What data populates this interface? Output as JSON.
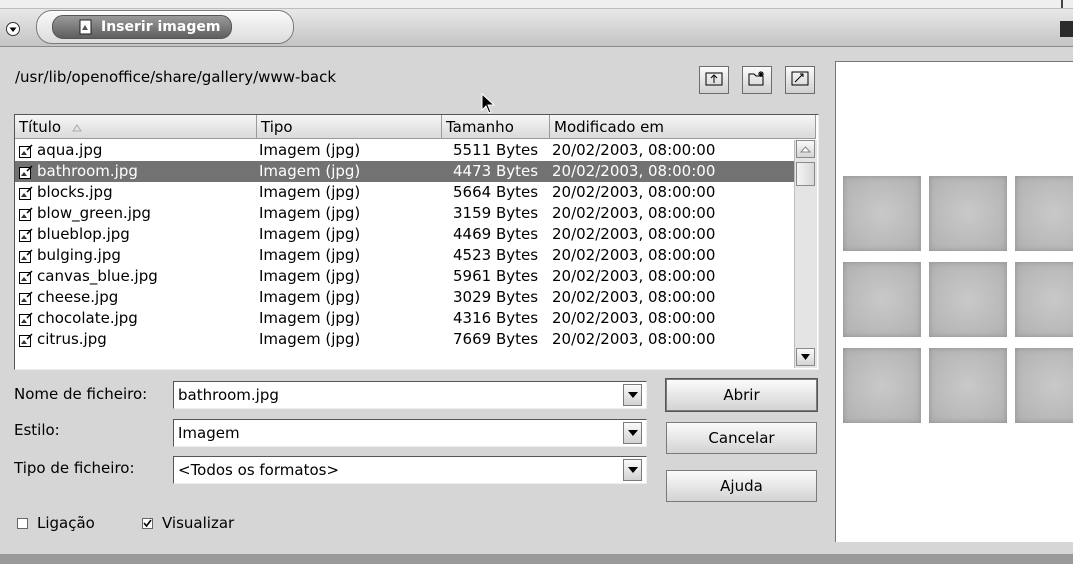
{
  "window": {
    "title": "Inserir imagem"
  },
  "path": "/usr/lib/openoffice/share/gallery/www-back",
  "toolbar": [
    "folder-up-icon",
    "new-folder-icon",
    "default-dir-icon"
  ],
  "list": {
    "headers": [
      "Título",
      "Tipo",
      "Tamanho",
      "Modificado em"
    ],
    "rows": [
      {
        "name": "aqua.jpg",
        "type": "Imagem (jpg)",
        "size": "5511 Bytes",
        "date": "20/02/2003, 08:00:00"
      },
      {
        "name": "bathroom.jpg",
        "type": "Imagem (jpg)",
        "size": "4473 Bytes",
        "date": "20/02/2003, 08:00:00",
        "selected": true
      },
      {
        "name": "blocks.jpg",
        "type": "Imagem (jpg)",
        "size": "5664 Bytes",
        "date": "20/02/2003, 08:00:00"
      },
      {
        "name": "blow_green.jpg",
        "type": "Imagem (jpg)",
        "size": "3159 Bytes",
        "date": "20/02/2003, 08:00:00"
      },
      {
        "name": "blueblop.jpg",
        "type": "Imagem (jpg)",
        "size": "4469 Bytes",
        "date": "20/02/2003, 08:00:00"
      },
      {
        "name": "bulging.jpg",
        "type": "Imagem (jpg)",
        "size": "4523 Bytes",
        "date": "20/02/2003, 08:00:00"
      },
      {
        "name": "canvas_blue.jpg",
        "type": "Imagem (jpg)",
        "size": "5961 Bytes",
        "date": "20/02/2003, 08:00:00"
      },
      {
        "name": "cheese.jpg",
        "type": "Imagem (jpg)",
        "size": "3029 Bytes",
        "date": "20/02/2003, 08:00:00"
      },
      {
        "name": "chocolate.jpg",
        "type": "Imagem (jpg)",
        "size": "4316 Bytes",
        "date": "20/02/2003, 08:00:00"
      },
      {
        "name": "citrus.jpg",
        "type": "Imagem (jpg)",
        "size": "7669 Bytes",
        "date": "20/02/2003, 08:00:00"
      }
    ]
  },
  "form": {
    "filename_label": "Nome de ficheiro:",
    "filename_value": "bathroom.jpg",
    "style_label": "Estilo:",
    "style_value": "Imagem",
    "filetype_label": "Tipo de ficheiro:",
    "filetype_value": "<Todos os formatos>"
  },
  "buttons": {
    "open": "Abrir",
    "cancel": "Cancelar",
    "help": "Ajuda"
  },
  "options": {
    "link_label": "Ligação",
    "link_checked": false,
    "preview_label": "Visualizar",
    "preview_checked": true
  }
}
